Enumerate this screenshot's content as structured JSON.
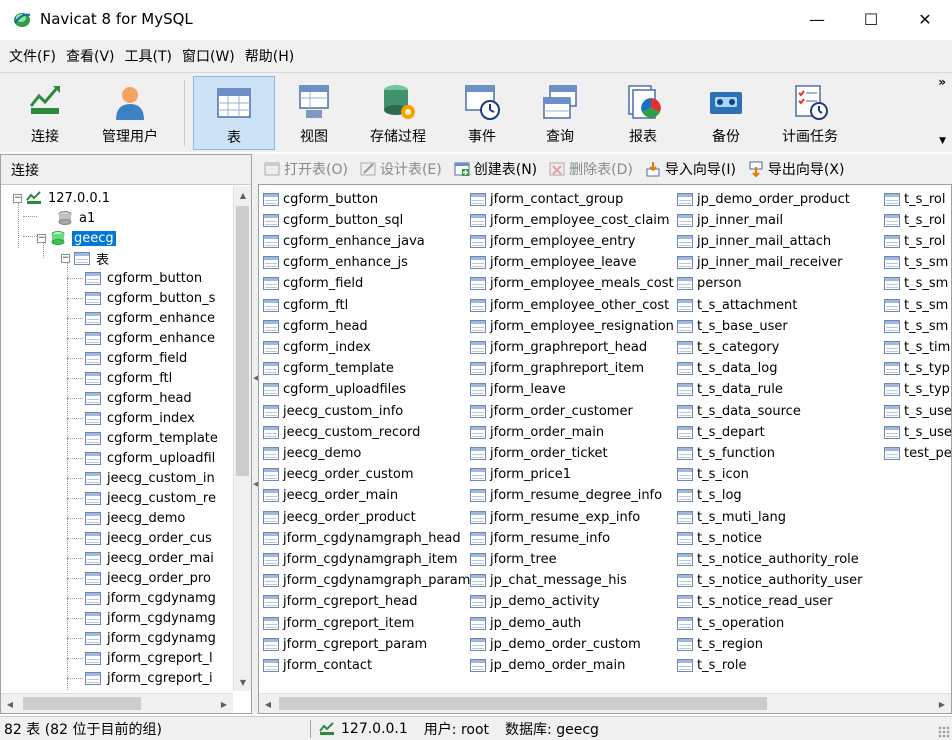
{
  "window": {
    "title": "Navicat 8 for MySQL",
    "minimize": "—",
    "maximize": "☐",
    "close": "✕"
  },
  "menu": [
    "文件(F)",
    "查看(V)",
    "工具(T)",
    "窗口(W)",
    "帮助(H)"
  ],
  "toolbar": {
    "connect": "连接",
    "manage_users": "管理用户",
    "buttons": [
      "表",
      "视图",
      "存储过程",
      "事件",
      "查询",
      "报表",
      "备份",
      "计画任务"
    ],
    "active": "表",
    "more": "»",
    "dropdown": "▼"
  },
  "left_panel": {
    "header": "连接",
    "connection": "127.0.0.1",
    "databases": [
      "a1",
      "geecg"
    ],
    "selected_db": "geecg",
    "tables_node": "表",
    "tables": [
      "cgform_button",
      "cgform_button_s",
      "cgform_enhance",
      "cgform_enhance",
      "cgform_field",
      "cgform_ftl",
      "cgform_head",
      "cgform_index",
      "cgform_template",
      "cgform_uploadfil",
      "jeecg_custom_in",
      "jeecg_custom_re",
      "jeecg_demo",
      "jeecg_order_cus",
      "jeecg_order_mai",
      "jeecg_order_pro",
      "jform_cgdynamg",
      "jform_cgdynamg",
      "jform_cgdynamg",
      "jform_cgreport_l",
      "jform_cgreport_i"
    ]
  },
  "right_toolbar": {
    "open_table": "打开表(O)",
    "design_table": "设计表(E)",
    "create_table": "创建表(N)",
    "delete_table": "删除表(D)",
    "import_wizard": "导入向导(I)",
    "export_wizard": "导出向导(X)"
  },
  "table_columns": [
    [
      "cgform_button",
      "cgform_button_sql",
      "cgform_enhance_java",
      "cgform_enhance_js",
      "cgform_field",
      "cgform_ftl",
      "cgform_head",
      "cgform_index",
      "cgform_template",
      "cgform_uploadfiles",
      "jeecg_custom_info",
      "jeecg_custom_record",
      "jeecg_demo",
      "jeecg_order_custom",
      "jeecg_order_main",
      "jeecg_order_product",
      "jform_cgdynamgraph_head",
      "jform_cgdynamgraph_item",
      "jform_cgdynamgraph_param",
      "jform_cgreport_head",
      "jform_cgreport_item",
      "jform_cgreport_param",
      "jform_contact"
    ],
    [
      "jform_contact_group",
      "jform_employee_cost_claim",
      "jform_employee_entry",
      "jform_employee_leave",
      "jform_employee_meals_cost",
      "jform_employee_other_cost",
      "jform_employee_resignation",
      "jform_graphreport_head",
      "jform_graphreport_item",
      "jform_leave",
      "jform_order_customer",
      "jform_order_main",
      "jform_order_ticket",
      "jform_price1",
      "jform_resume_degree_info",
      "jform_resume_exp_info",
      "jform_resume_info",
      "jform_tree",
      "jp_chat_message_his",
      "jp_demo_activity",
      "jp_demo_auth",
      "jp_demo_order_custom",
      "jp_demo_order_main"
    ],
    [
      "jp_demo_order_product",
      "jp_inner_mail",
      "jp_inner_mail_attach",
      "jp_inner_mail_receiver",
      "person",
      "t_s_attachment",
      "t_s_base_user",
      "t_s_category",
      "t_s_data_log",
      "t_s_data_rule",
      "t_s_data_source",
      "t_s_depart",
      "t_s_function",
      "t_s_icon",
      "t_s_log",
      "t_s_muti_lang",
      "t_s_notice",
      "t_s_notice_authority_role",
      "t_s_notice_authority_user",
      "t_s_notice_read_user",
      "t_s_operation",
      "t_s_region",
      "t_s_role"
    ],
    [
      "t_s_rol",
      "t_s_rol",
      "t_s_rol",
      "t_s_sm",
      "t_s_sm",
      "t_s_sm",
      "t_s_sm",
      "t_s_tim",
      "t_s_typ",
      "t_s_typ",
      "t_s_use",
      "t_s_use",
      "test_pe"
    ]
  ],
  "status": {
    "count": "82 表 (82 位于目前的组)",
    "host": "127.0.0.1",
    "user": "用户: root",
    "database": "数据库: geecg"
  },
  "colors": {
    "selection": "#0078d7",
    "active_toolbar": "#cde2f7",
    "chrome": "#f0f0f0"
  }
}
